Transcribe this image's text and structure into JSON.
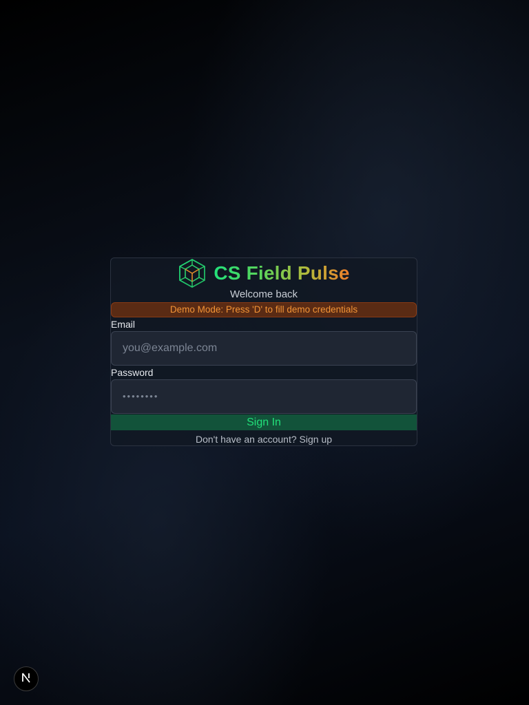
{
  "brand": {
    "title": "CS Field Pulse",
    "logo_icon": "hexagon-cube-icon",
    "gradient_colors": [
      "#22e07a",
      "#5bd45a",
      "#b7b83a",
      "#ef7d2a"
    ]
  },
  "login": {
    "subtitle": "Welcome back",
    "demo_banner": "Demo Mode: Press 'D' to fill demo credentials",
    "email_label": "Email",
    "email_placeholder": "you@example.com",
    "password_label": "Password",
    "password_placeholder": "••••••••",
    "submit_label": "Sign In",
    "signup_prompt": "Don't have an account?",
    "signup_link": "Sign up"
  },
  "dev_badge": {
    "icon": "nextjs-logo-icon",
    "letter": "N"
  },
  "colors": {
    "accent_green": "#22e07a",
    "button_bg": "#12533a",
    "banner_bg": "#5a2b14",
    "banner_text": "#f39436"
  }
}
